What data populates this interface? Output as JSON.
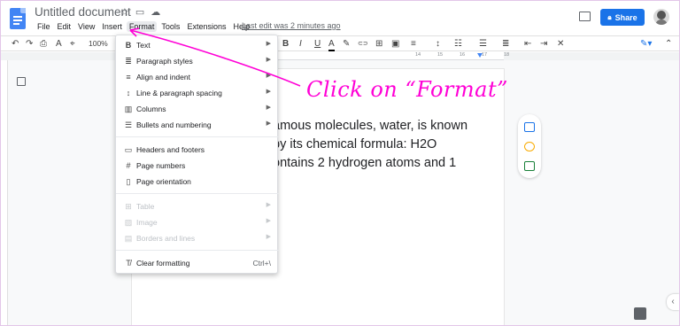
{
  "header": {
    "title": "Untitled document",
    "icons": [
      "star-icon",
      "folder-move-icon",
      "cloud-status-icon"
    ],
    "last_edit": "Last edit was 2 minutes ago",
    "share_label": "Share"
  },
  "menubar": [
    "File",
    "Edit",
    "View",
    "Insert",
    "Format",
    "Tools",
    "Extensions",
    "Help"
  ],
  "toolbar": {
    "zoom": "100%",
    "left_glyphs": [
      "↶",
      "↷",
      "⎙",
      "A",
      "⌖"
    ],
    "right_glyphs": [
      "B",
      "I",
      "U",
      "A",
      "✎",
      "⊂⊃",
      "⊞",
      "▣",
      "≡",
      "↕",
      "☷",
      "☰",
      "≣",
      "⇤",
      "⇥",
      "✕"
    ]
  },
  "ruler": {
    "numbers": [
      "14",
      "15",
      "16",
      "17",
      "18"
    ]
  },
  "format_menu": {
    "items": [
      {
        "label": "Text",
        "icon": "B",
        "submenu": true,
        "disabled": false
      },
      {
        "label": "Paragraph styles",
        "icon": "≣",
        "submenu": true,
        "disabled": false
      },
      {
        "label": "Align and indent",
        "icon": "≡",
        "submenu": true,
        "disabled": false
      },
      {
        "label": "Line & paragraph spacing",
        "icon": "↕",
        "submenu": true,
        "disabled": false
      },
      {
        "label": "Columns",
        "icon": "▥",
        "submenu": true,
        "disabled": false
      },
      {
        "label": "Bullets and numbering",
        "icon": "☰",
        "submenu": true,
        "disabled": false
      },
      {
        "label": "Headers and footers",
        "icon": "▭",
        "submenu": false,
        "disabled": false
      },
      {
        "label": "Page numbers",
        "icon": "#",
        "submenu": false,
        "disabled": false
      },
      {
        "label": "Page orientation",
        "icon": "▯",
        "submenu": false,
        "disabled": false
      },
      {
        "label": "Table",
        "icon": "⊞",
        "submenu": true,
        "disabled": true
      },
      {
        "label": "Image",
        "icon": "▨",
        "submenu": true,
        "disabled": true
      },
      {
        "label": "Borders and lines",
        "icon": "▤",
        "submenu": true,
        "disabled": true
      },
      {
        "label": "Clear formatting",
        "icon": "T̸",
        "submenu": false,
        "disabled": false,
        "shortcut": "Ctrl+\\"
      }
    ]
  },
  "document": {
    "lines": [
      "amous molecules, water, is known",
      "by its chemical formula: H2O",
      "ontains 2 hydrogen atoms and 1"
    ]
  },
  "annotation": {
    "text": "Click on “Format”",
    "color": "#ff00d6"
  },
  "colors": {
    "share_blue": "#1a73e8",
    "docs_blue": "#4285f4"
  }
}
